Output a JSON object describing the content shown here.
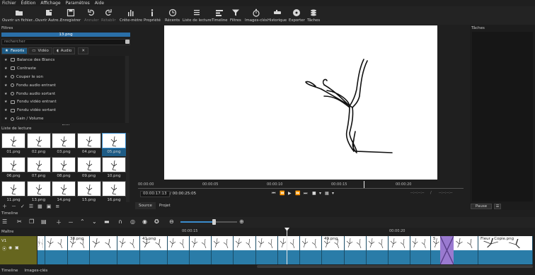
{
  "menu": [
    "Fichier",
    "Édition",
    "Affichage",
    "Paramètres",
    "Aide"
  ],
  "toolbar": {
    "open_file": "Ouvrir un fichier...",
    "open_other": "Ouvrir Autre...",
    "save": "Enregistrer",
    "undo": "Annuler",
    "redo": "Rétablir",
    "peak_meter": "Crête-mètre",
    "properties": "Propriété",
    "recent": "Récents",
    "playlist": "Liste de lecture",
    "timeline": "Timeline",
    "filters": "Filtres",
    "keyframes": "Images-clés",
    "history": "Historique",
    "export": "Exporter",
    "jobs": "Tâches"
  },
  "filters_panel": {
    "title": "Filtres",
    "selected_clip": "13.png",
    "search_placeholder": "rechercher",
    "tabs": [
      "Favoris",
      "Vidéo",
      "Audio"
    ],
    "items": [
      {
        "label": "Balance des Blancs",
        "kind": "video"
      },
      {
        "label": "Contraste",
        "kind": "video"
      },
      {
        "label": "Couper le son",
        "kind": "audio"
      },
      {
        "label": "Fondu audio entrant",
        "kind": "audio"
      },
      {
        "label": "Fondu audio sortant",
        "kind": "audio"
      },
      {
        "label": "Fondu vidéo entrant",
        "kind": "video"
      },
      {
        "label": "Fondu vidéo sortant",
        "kind": "video"
      },
      {
        "label": "Gain / Volume",
        "kind": "audio"
      }
    ]
  },
  "playlist": {
    "title": "Liste de lecture",
    "items": [
      "01.png",
      "02.png",
      "03.png",
      "04.png",
      "05.png",
      "06.png",
      "07.png",
      "08.png",
      "09.png",
      "10.png",
      "11.png",
      "13.png",
      "14.png",
      "15.png",
      "16.png"
    ],
    "selected": "05.png"
  },
  "viewer": {
    "ruler_ticks": [
      "00:00:00",
      "00:00:05",
      "00:00:10",
      "00:00:15",
      "00:00:20"
    ],
    "current_time": "00:00:17:13",
    "duration": "/ 00:00:25:05",
    "in_point": "--:--:--:--",
    "out_point": "--:--:--:--",
    "sep": "/",
    "tabs": [
      "Source",
      "Projet"
    ]
  },
  "jobs_panel": {
    "title": "Tâches",
    "pause": "Pause",
    "menu": "☰"
  },
  "timeline": {
    "title": "Timeline",
    "master": "Maître",
    "track": "V1",
    "ruler_ticks": [
      "00:00:15",
      "00:00:20"
    ],
    "clip_labels": [
      "38.png",
      "41.png",
      "49.png",
      "5",
      "Fleur - Copie.png"
    ]
  },
  "bottom_tabs": [
    "Timeline",
    "Images-clés"
  ],
  "colors": {
    "accent": "#2a6fa8",
    "track": "#2a7ca8",
    "track_header": "#66661f",
    "transition": "#9a7ad0"
  }
}
